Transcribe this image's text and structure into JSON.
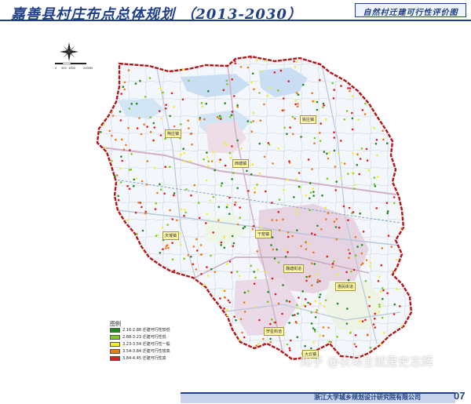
{
  "header": {
    "title": "嘉善县村庄布点总体规划 （2013-2030）",
    "subtitle": "自然村迁建可行性评价图"
  },
  "scale_bar": {
    "labels": [
      "0",
      "500",
      "1000",
      "2000M"
    ]
  },
  "places": [
    {
      "name": "陶庄镇"
    },
    {
      "name": "西塘镇"
    },
    {
      "name": "姚庄镇"
    },
    {
      "name": "天凝镇"
    },
    {
      "name": "干窑镇"
    },
    {
      "name": "魏塘街道"
    },
    {
      "name": "惠民街道"
    },
    {
      "name": "罗星街道"
    },
    {
      "name": "大云镇"
    }
  ],
  "legend": {
    "title": "图例",
    "items": [
      {
        "label": "2.16-2.88 迁建可行性较低",
        "color": "#1e8a1e"
      },
      {
        "label": "2.88-3.23 迁建可行性低",
        "color": "#7ccc1c"
      },
      {
        "label": "3.23-3.54 迁建可行性一般",
        "color": "#f3ee2a"
      },
      {
        "label": "3.54-3.84 迁建可行性较高",
        "color": "#f07a1a"
      },
      {
        "label": "3.84-4.45 迁建可行性高",
        "color": "#e51c1c"
      }
    ]
  },
  "footer": {
    "institute": "浙江大学城乡规划设计研究院有限公司",
    "page_number": "07"
  },
  "watermark": "知乎 @农场主就是史志辉",
  "colors": {
    "boundary": "#b01818",
    "title_blue": "#1f3f86",
    "land": "#f3f7fb"
  }
}
